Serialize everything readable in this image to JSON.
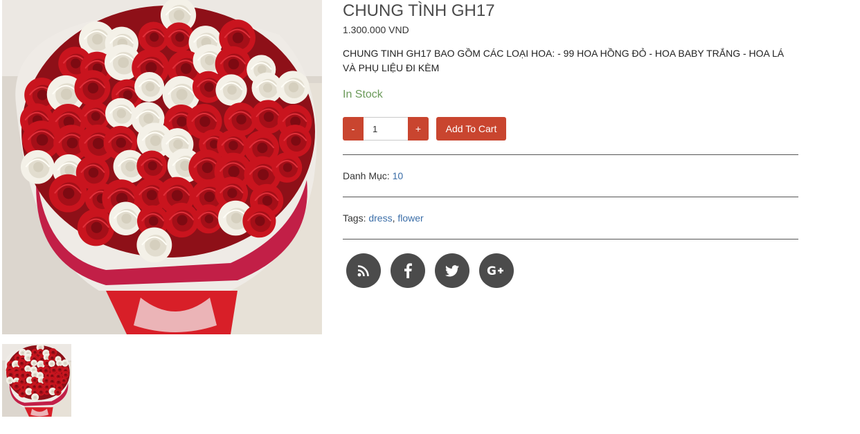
{
  "product": {
    "title": "CHUNG TÌNH GH17",
    "price": "1.300.000 VND",
    "description": "CHUNG TINH GH17 BAO GỒM CÁC LOẠI HOA: - 99 HOA HỒNG ĐỎ - HOA BABY TRẮNG - HOA LÁ VÀ PHỤ LIỆU ĐI KÈM",
    "stock_status": "In Stock"
  },
  "cart": {
    "minus_label": "-",
    "plus_label": "+",
    "quantity": "1",
    "add_label": "Add To Cart"
  },
  "meta": {
    "category_label": "Danh Mục:",
    "category_value": "10",
    "tags_label": "Tags:",
    "tags": [
      "dress",
      "flower"
    ],
    "tag_separator": ", "
  },
  "social": [
    "rss-icon",
    "facebook-icon",
    "twitter-icon",
    "google-plus-icon"
  ],
  "colors": {
    "accent": "#c9452f",
    "stock": "#6b9a5a",
    "link": "#3b6ea8",
    "social_bg": "#4b4b4b"
  }
}
